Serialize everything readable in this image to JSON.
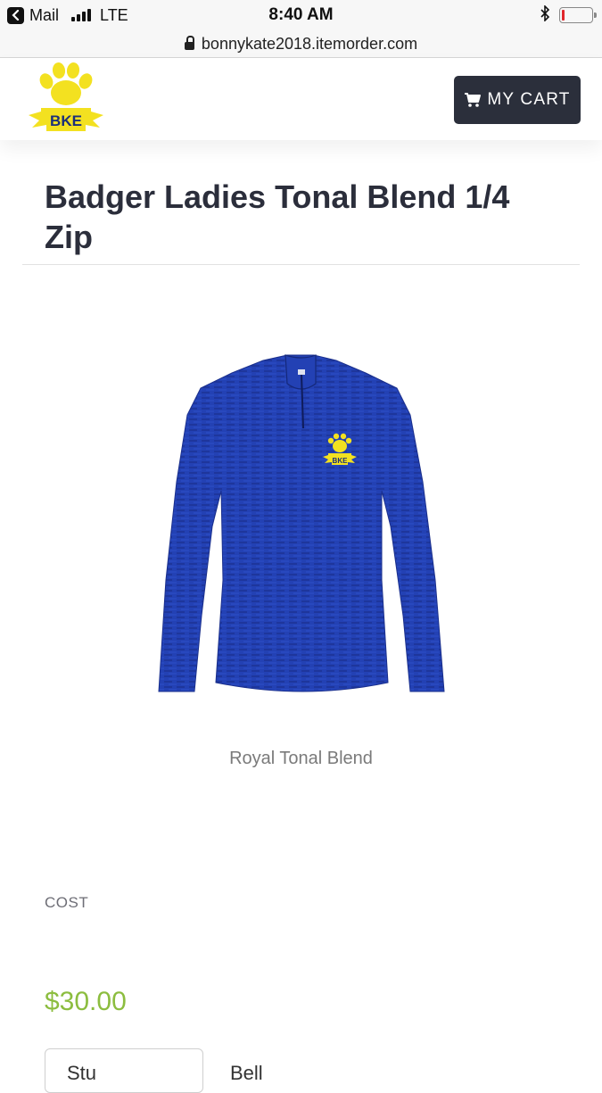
{
  "status_bar": {
    "back_app": "Mail",
    "carrier": "LTE",
    "time": "8:40 AM",
    "battery_level": 0.1,
    "icons": [
      "back-arrow-icon",
      "signal-icon",
      "bluetooth-icon",
      "battery-icon"
    ]
  },
  "browser": {
    "url": "bonnykate2018.itemorder.com",
    "icons": [
      "lock-icon"
    ]
  },
  "header": {
    "logo_text": "BKE",
    "cart_label": "MY CART",
    "icons": [
      "paw-logo",
      "cart-icon"
    ],
    "colors": {
      "cart_bg": "#2b2f3b",
      "logo_yellow": "#f3e120"
    }
  },
  "product": {
    "title": "Badger Ladies Tonal Blend 1/4 Zip",
    "image_caption": "Royal Tonal Blend",
    "chest_logo_text": "BKE",
    "colors": {
      "shirt": "#2341b4"
    }
  },
  "pricing": {
    "cost_label": "COST",
    "price": "$30.00",
    "colors": {
      "price": "#8cbd3f"
    }
  },
  "options": {
    "first_option_partial": "Stu",
    "second_option_partial": "Bell"
  }
}
